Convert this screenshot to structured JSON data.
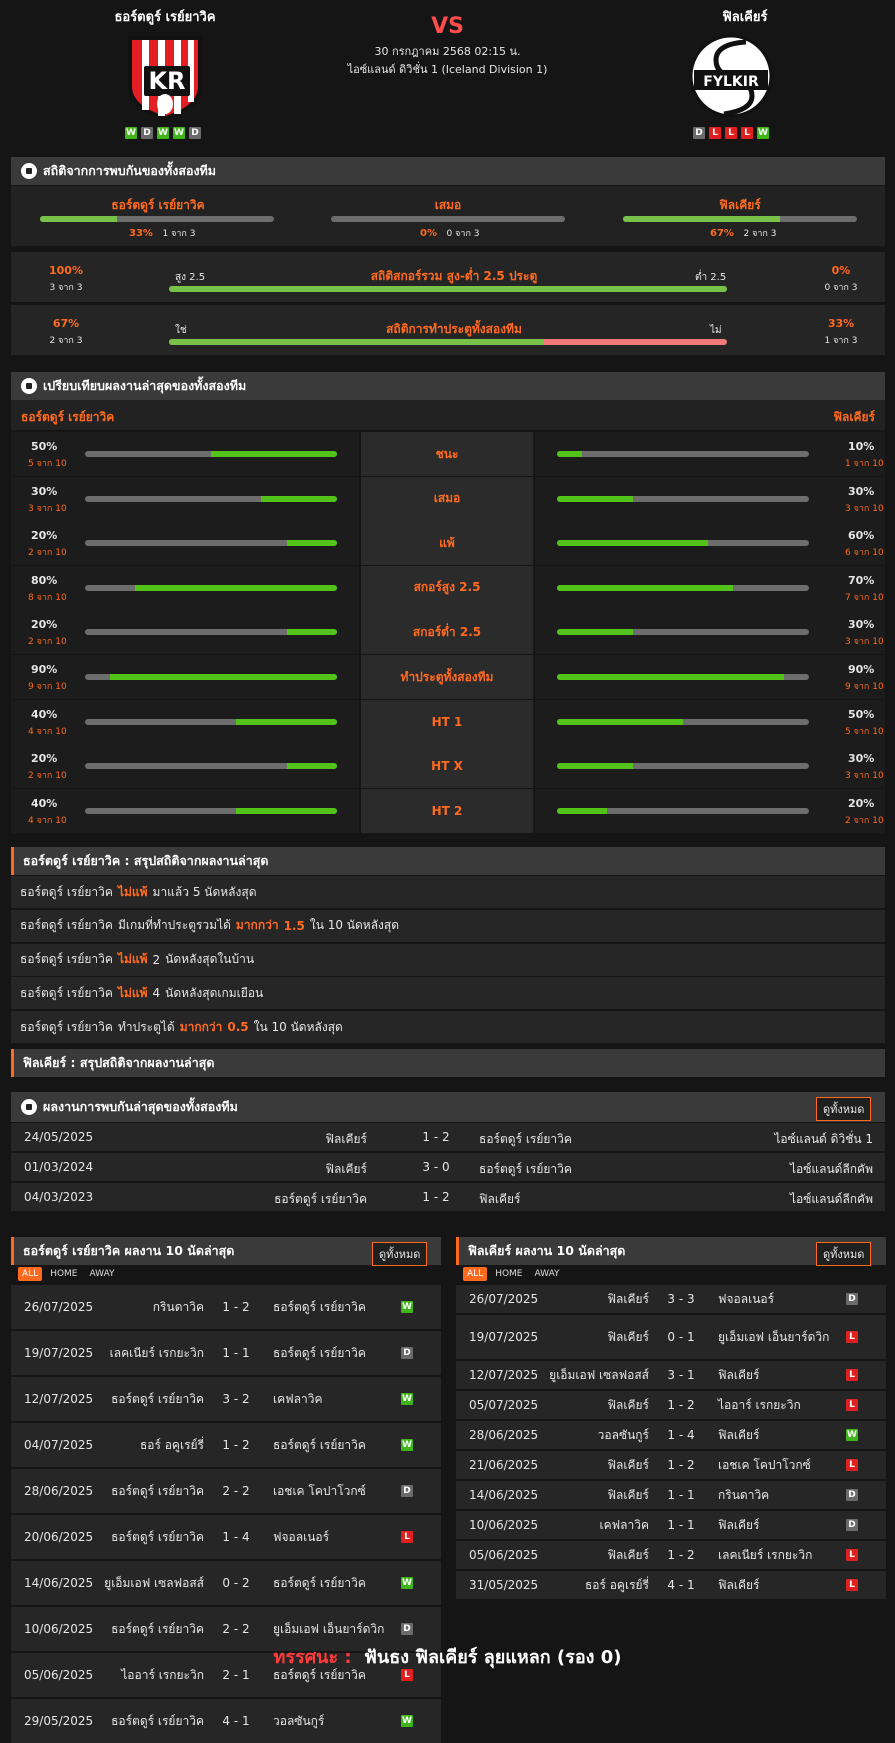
{
  "header": {
    "home": "ธอร์ตดูร์ เรย์ยาวิค",
    "away": "ฟิลเคียร์",
    "vs": "VS",
    "date": "30 กรกฎาคม 2568 02:15 น.",
    "league": "ไอซ์แลนด์ ดิวิชั่น 1 (Iceland Division 1)",
    "home_logo": "KR",
    "away_logo": "FYLKIR",
    "home_form": [
      "W",
      "D",
      "W",
      "W",
      "D"
    ],
    "away_form": [
      "D",
      "L",
      "L",
      "L",
      "W"
    ]
  },
  "h2h_stats": {
    "title": "สถิติจากการพบกันของทั้งสองทีม",
    "home": {
      "label": "ธอร์ตดูร์ เรย์ยาวิค",
      "pct": "33%",
      "count": "1 จาก 3",
      "fill": 33
    },
    "draw": {
      "label": "เสมอ",
      "pct": "0%",
      "count": "0 จาก 3",
      "fill": 0
    },
    "away": {
      "label": "ฟิลเคียร์",
      "pct": "67%",
      "count": "2 จาก 3",
      "fill": 67
    }
  },
  "ou": {
    "title": "สถิติสกอร์รวม สูง-ต่ำ 2.5 ประตู",
    "left_pct": "100%",
    "left_count": "3 จาก 3",
    "left_label": "สูง 2.5",
    "right_label": "ต่ำ 2.5",
    "right_pct": "0%",
    "right_count": "0 จาก 3",
    "fill": 100
  },
  "btts": {
    "title": "สถิติการทำประตูทั้งสองทีม",
    "left_pct": "67%",
    "left_count": "2 จาก 3",
    "left_label": "ใช่",
    "right_label": "ไม่",
    "right_pct": "33%",
    "right_count": "1 จาก 3",
    "fill": 67
  },
  "compare": {
    "title": "เปรียบเทียบผลงานล่าสุดของทั้งสองทีม",
    "home": "ธอร์ตดูร์ เรย์ยาวิค",
    "away": "ฟิลเคียร์",
    "rows": [
      {
        "label": "ชนะ",
        "hp": "50%",
        "hc": "5 จาก 10",
        "hv": 50,
        "ap": "10%",
        "ac": "1 จาก 10",
        "av": 10
      },
      {
        "label": "เสมอ",
        "hp": "30%",
        "hc": "3 จาก 10",
        "hv": 30,
        "ap": "30%",
        "ac": "3 จาก 10",
        "av": 30
      },
      {
        "label": "แพ้",
        "hp": "20%",
        "hc": "2 จาก 10",
        "hv": 20,
        "ap": "60%",
        "ac": "6 จาก 10",
        "av": 60
      },
      {
        "label": "สกอร์สูง 2.5",
        "hp": "80%",
        "hc": "8 จาก 10",
        "hv": 80,
        "ap": "70%",
        "ac": "7 จาก 10",
        "av": 70
      },
      {
        "label": "สกอร์ต่ำ 2.5",
        "hp": "20%",
        "hc": "2 จาก 10",
        "hv": 20,
        "ap": "30%",
        "ac": "3 จาก 10",
        "av": 30
      },
      {
        "label": "ทำประตูทั้งสองทีม",
        "hp": "90%",
        "hc": "9 จาก 10",
        "hv": 90,
        "ap": "90%",
        "ac": "9 จาก 10",
        "av": 90
      },
      {
        "label": "HT 1",
        "hp": "40%",
        "hc": "4 จาก 10",
        "hv": 40,
        "ap": "50%",
        "ac": "5 จาก 10",
        "av": 50
      },
      {
        "label": "HT X",
        "hp": "20%",
        "hc": "2 จาก 10",
        "hv": 20,
        "ap": "30%",
        "ac": "3 จาก 10",
        "av": 30
      },
      {
        "label": "HT 2",
        "hp": "40%",
        "hc": "4 จาก 10",
        "hv": 40,
        "ap": "20%",
        "ac": "2 จาก 10",
        "av": 20
      }
    ]
  },
  "summary_home": {
    "title": "ธอร์ตดูร์ เรย์ยาวิค : สรุปสถิติจากผลงานล่าสุด",
    "rows": [
      [
        "ธอร์ตดูร์ เรย์ยาวิค",
        "ไม่แพ้",
        "มาแล้ว 5 นัดหลังสุด"
      ],
      [
        "ธอร์ตดูร์ เรย์ยาวิค",
        "มีเกมที่ทำประตูรวมได้",
        "มากกว่า",
        "1.5",
        "ใน 10 นัดหลังสุด"
      ],
      [
        "ธอร์ตดูร์ เรย์ยาวิค",
        "ไม่แพ้",
        "2",
        "นัดหลังสุดในบ้าน"
      ],
      [
        "ธอร์ตดูร์ เรย์ยาวิค",
        "ไม่แพ้",
        "4",
        "นัดหลังสุดเกมเยือน"
      ],
      [
        "ธอร์ตดูร์ เรย์ยาวิค",
        "ทำประตูได้",
        "มากกว่า",
        "0.5",
        "ใน 10 นัดหลังสุด"
      ]
    ]
  },
  "summary_away": {
    "title": "ฟิลเคียร์ : สรุปสถิติจากผลงานล่าสุด"
  },
  "h2h": {
    "title": "ผลงานการพบกันล่าสุดของทั้งสองทีม",
    "view_all": "ดูทั้งหมด",
    "rows": [
      [
        "24/05/2025",
        "ฟิลเคียร์",
        "1 - 2",
        "ธอร์ตดูร์ เรย์ยาวิค",
        "ไอซ์แลนด์ ดิวิชั่น 1"
      ],
      [
        "01/03/2024",
        "ฟิลเคียร์",
        "3 - 0",
        "ธอร์ตดูร์ เรย์ยาวิค",
        "ไอซ์แลนด์ลีกคัพ"
      ],
      [
        "04/03/2023",
        "ธอร์ตดูร์ เรย์ยาวิค",
        "1 - 2",
        "ฟิลเคียร์",
        "ไอซ์แลนด์ลีกคัพ"
      ]
    ]
  },
  "last_home": {
    "title": "ธอร์ตดูร์ เรย์ยาวิค ผลงาน 10 นัดล่าสุด",
    "view_all": "ดูทั้งหมด",
    "tabs": [
      "ALL",
      "HOME",
      "AWAY"
    ],
    "rows": [
      [
        "26/07/2025",
        "กรินดาวิค",
        "1 - 2",
        "ธอร์ตดูร์ เรย์ยาวิค",
        "W"
      ],
      [
        "19/07/2025",
        "เลคเนียร์ เรกยะวิก",
        "1 - 1",
        "ธอร์ตดูร์ เรย์ยาวิค",
        "D"
      ],
      [
        "12/07/2025",
        "ธอร์ตดูร์ เรย์ยาวิค",
        "3 - 2",
        "เคฟลาวิค",
        "W"
      ],
      [
        "04/07/2025",
        "ธอร์ อคูเรย์รี่",
        "1 - 2",
        "ธอร์ตดูร์ เรย์ยาวิค",
        "W"
      ],
      [
        "28/06/2025",
        "ธอร์ตดูร์ เรย์ยาวิค",
        "2 - 2",
        "เอชเค โคปาโวกซ์",
        "D"
      ],
      [
        "20/06/2025",
        "ธอร์ตดูร์ เรย์ยาวิค",
        "1 - 4",
        "ฟจอลเนอร์",
        "L"
      ],
      [
        "14/06/2025",
        "ยูเอ็มเอฟ เซลฟอสส์",
        "0 - 2",
        "ธอร์ตดูร์ เรย์ยาวิค",
        "W"
      ],
      [
        "10/06/2025",
        "ธอร์ตดูร์ เรย์ยาวิค",
        "2 - 2",
        "ยูเอ็มเอฟ เอ็นยาร์ดวิก",
        "D"
      ],
      [
        "05/06/2025",
        "ไออาร์ เรกยะวิก",
        "2 - 1",
        "ธอร์ตดูร์ เรย์ยาวิค",
        "L"
      ],
      [
        "29/05/2025",
        "ธอร์ตดูร์ เรย์ยาวิค",
        "4 - 1",
        "วอลซันกูร์",
        "W"
      ]
    ]
  },
  "last_away": {
    "title": "ฟิลเคียร์ ผลงาน 10 นัดล่าสุด",
    "view_all": "ดูทั้งหมด",
    "tabs": [
      "ALL",
      "HOME",
      "AWAY"
    ],
    "rows": [
      [
        "26/07/2025",
        "ฟิลเคียร์",
        "3 - 3",
        "ฟจอลเนอร์",
        "D"
      ],
      [
        "19/07/2025",
        "ฟิลเคียร์",
        "0 - 1",
        "ยูเอ็มเอฟ เอ็นยาร์ดวิก",
        "L"
      ],
      [
        "12/07/2025",
        "ยูเอ็มเอฟ เซลฟอสส์",
        "3 - 1",
        "ฟิลเคียร์",
        "L"
      ],
      [
        "05/07/2025",
        "ฟิลเคียร์",
        "1 - 2",
        "ไออาร์ เรกยะวิก",
        "L"
      ],
      [
        "28/06/2025",
        "วอลซันกูร์",
        "1 - 4",
        "ฟิลเคียร์",
        "W"
      ],
      [
        "21/06/2025",
        "ฟิลเคียร์",
        "1 - 2",
        "เอชเค โคปาโวกซ์",
        "L"
      ],
      [
        "14/06/2025",
        "ฟิลเคียร์",
        "1 - 1",
        "กรินดาวิค",
        "D"
      ],
      [
        "10/06/2025",
        "เคฟลาวิค",
        "1 - 1",
        "ฟิลเคียร์",
        "D"
      ],
      [
        "05/06/2025",
        "ฟิลเคียร์",
        "1 - 2",
        "เลคเนียร์ เรกยะวิก",
        "L"
      ],
      [
        "31/05/2025",
        "ธอร์ อคูเรย์รี่",
        "4 - 1",
        "ฟิลเคียร์",
        "L"
      ]
    ]
  },
  "prediction": {
    "label": "ทรรศนะ :",
    "text": "ฟันธง ฟิลเคียร์ ลุยแหลก (รอง 0)"
  }
}
